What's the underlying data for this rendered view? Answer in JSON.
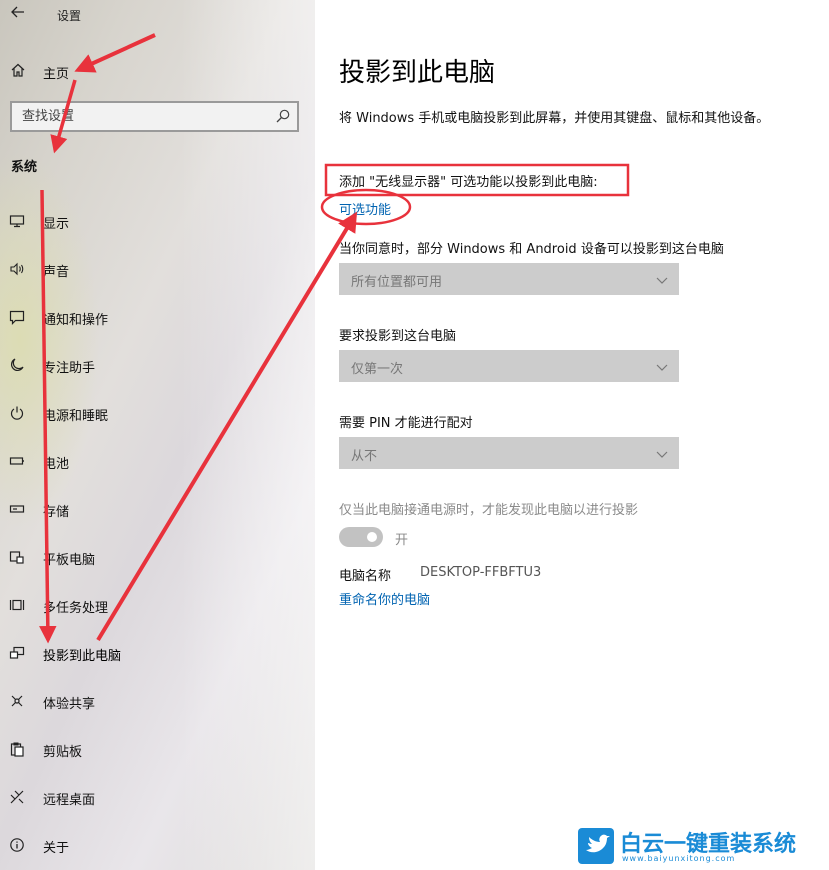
{
  "window": {
    "title": "设置"
  },
  "sidebar": {
    "home_label": "主页",
    "search_placeholder": "查找设置",
    "section_title": "系统",
    "items": [
      {
        "label": "显示",
        "icon": "monitor-icon"
      },
      {
        "label": "声音",
        "icon": "speaker-icon"
      },
      {
        "label": "通知和操作",
        "icon": "notification-icon"
      },
      {
        "label": "专注助手",
        "icon": "moon-icon"
      },
      {
        "label": "电源和睡眠",
        "icon": "power-icon"
      },
      {
        "label": "电池",
        "icon": "battery-icon"
      },
      {
        "label": "存储",
        "icon": "storage-icon"
      },
      {
        "label": "平板电脑",
        "icon": "tablet-icon"
      },
      {
        "label": "多任务处理",
        "icon": "multitask-icon"
      },
      {
        "label": "投影到此电脑",
        "icon": "project-icon",
        "active": true
      },
      {
        "label": "体验共享",
        "icon": "share-icon"
      },
      {
        "label": "剪贴板",
        "icon": "clipboard-icon"
      },
      {
        "label": "远程桌面",
        "icon": "remote-icon"
      },
      {
        "label": "关于",
        "icon": "info-icon"
      }
    ]
  },
  "main": {
    "title": "投影到此电脑",
    "description": "将 Windows 手机或电脑投影到此屏幕，并使用其键盘、鼠标和其他设备。",
    "add_feature_text": "添加 \"无线显示器\" 可选功能以投影到此电脑:",
    "optional_features_link": "可选功能",
    "setting1": {
      "label": "当你同意时，部分 Windows 和 Android 设备可以投影到这台电脑",
      "value": "所有位置都可用"
    },
    "setting2": {
      "label": "要求投影到这台电脑",
      "value": "仅第一次"
    },
    "setting3": {
      "label": "需要 PIN 才能进行配对",
      "value": "从不"
    },
    "power_label": "仅当此电脑接通电源时，才能发现此电脑以进行投影",
    "toggle_label": "开",
    "pc_name_label": "电脑名称",
    "pc_name_value": "DESKTOP-FFBFTU3",
    "rename_link": "重命名你的电脑"
  },
  "watermark": {
    "brand": "白云一键重装系统",
    "url": "www.baiyunxitong.com"
  },
  "colors": {
    "link": "#0063b1",
    "annotation": "#e8323c",
    "select_bg": "#cccccc"
  }
}
